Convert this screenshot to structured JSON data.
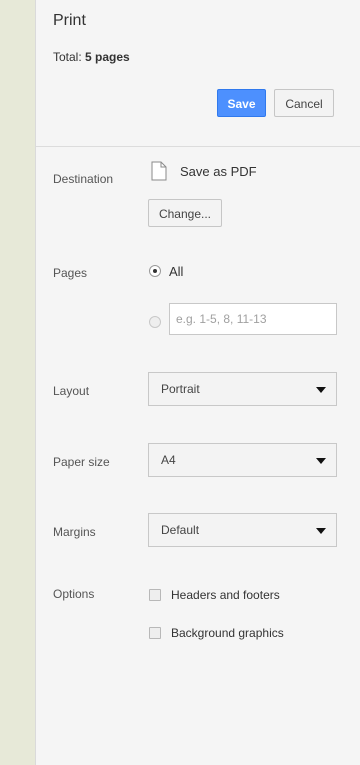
{
  "header": {
    "title": "Print",
    "total_label": "Total:",
    "total_value": "5 pages",
    "save_label": "Save",
    "cancel_label": "Cancel"
  },
  "destination": {
    "label": "Destination",
    "icon": "pdf-file-icon",
    "value": "Save as PDF",
    "change_label": "Change..."
  },
  "pages": {
    "label": "Pages",
    "all_label": "All",
    "all_selected": true,
    "custom_placeholder": "e.g. 1-5, 8, 11-13",
    "custom_value": ""
  },
  "layout": {
    "label": "Layout",
    "value": "Portrait"
  },
  "paper_size": {
    "label": "Paper size",
    "value": "A4"
  },
  "margins": {
    "label": "Margins",
    "value": "Default"
  },
  "options": {
    "label": "Options",
    "items": [
      {
        "label": "Headers and footers",
        "checked": false
      },
      {
        "label": "Background graphics",
        "checked": false
      }
    ]
  },
  "colors": {
    "accent": "#4d90fe",
    "panel_background": "#f5f5f5",
    "left_strip": "#e7e9d8"
  }
}
